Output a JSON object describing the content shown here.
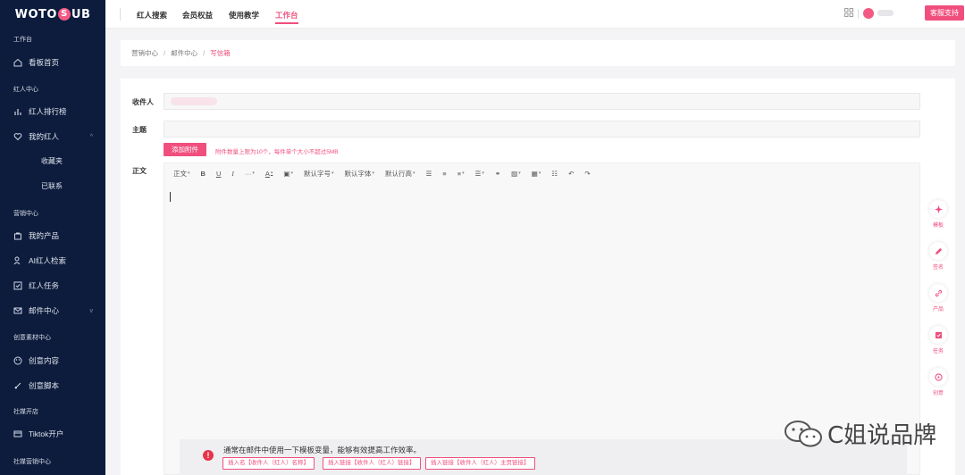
{
  "sidebar": {
    "logo_left": "WOTO",
    "logo_mid": "S",
    "logo_right": "UB",
    "sections": [
      "工作台",
      "红人中心",
      "营销中心",
      "创意素材中心",
      "社媒开店",
      "社媒营销中心"
    ],
    "items": [
      {
        "label": "看板首页",
        "icon": "home-icon"
      },
      {
        "label": "红人排行榜",
        "icon": "bar-chart-icon"
      },
      {
        "label": "我的红人",
        "icon": "heart-icon"
      },
      {
        "label": "我的产品",
        "icon": "bag-icon"
      },
      {
        "label": "AI红人检索",
        "icon": "user-search-icon"
      },
      {
        "label": "红人任务",
        "icon": "checkbox-icon"
      },
      {
        "label": "邮件中心",
        "icon": "mail-icon"
      },
      {
        "label": "创意内容",
        "icon": "palette-icon"
      },
      {
        "label": "创意脚本",
        "icon": "pen-icon"
      },
      {
        "label": "Tiktok开户",
        "icon": "card-icon"
      }
    ],
    "subitems": [
      "收藏夹",
      "已联系"
    ]
  },
  "topbar": {
    "tabs": [
      "红人搜索",
      "会员权益",
      "使用教学",
      "工作台"
    ],
    "active_tab": "工作台",
    "support_label": "客服支持"
  },
  "breadcrumb": {
    "items": [
      "营销中心",
      "邮件中心",
      "写信箱"
    ]
  },
  "form": {
    "recipient_label": "收件人",
    "subject_label": "主题",
    "subject_value": "",
    "attach_label": "添加附件",
    "attach_hint": "附件数量上限为10个，每件单个大小不超过5MB",
    "body_label": "正文"
  },
  "toolbar": {
    "paragraph": "正文",
    "font_size": "默认字号",
    "font_family": "默认字体",
    "line_height": "默认行高"
  },
  "tip": {
    "text": "通常在邮件中使用一下模板变量，能够有效提高工作效率。",
    "tags": [
      "插入名【收件人（红人）名称】",
      "插入链接【收件人（红人）链接】",
      "插入链接【收件人（红人）主页链接】"
    ]
  },
  "float_buttons": [
    {
      "label": "模板",
      "icon": "template-icon"
    },
    {
      "label": "签名",
      "icon": "signature-icon"
    },
    {
      "label": "产品",
      "icon": "link-icon"
    },
    {
      "label": "任务",
      "icon": "task-icon"
    },
    {
      "label": "创意",
      "icon": "creative-icon"
    }
  ],
  "watermark": "C姐说品牌",
  "colors": {
    "accent": "#f04f7e",
    "sidebar_bg": "#0d1c3d",
    "alert_red": "#e8334a"
  }
}
